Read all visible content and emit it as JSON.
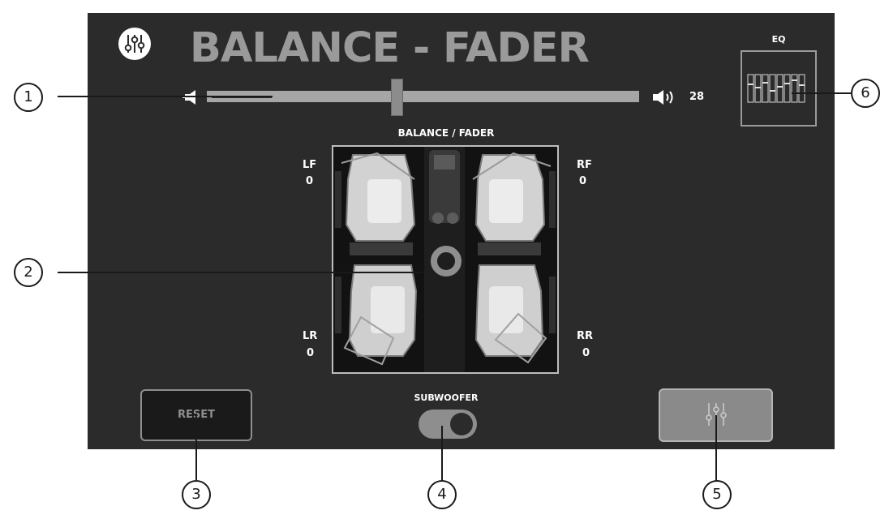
{
  "header": {
    "title": "BALANCE - FADER",
    "app_icon": "sliders-icon"
  },
  "volume": {
    "low_icon": "speaker-low-icon",
    "high_icon": "speaker-high-icon",
    "value": "28",
    "level_fraction": 0.44
  },
  "eq_preview": {
    "label": "EQ",
    "icon": "eq-sliders-icon"
  },
  "balance_fader": {
    "label": "BALANCE / FADER",
    "speakers": {
      "lf": {
        "label": "LF",
        "value": "0"
      },
      "rf": {
        "label": "RF",
        "value": "0"
      },
      "lr": {
        "label": "LR",
        "value": "0"
      },
      "rr": {
        "label": "RR",
        "value": "0"
      }
    }
  },
  "reset": {
    "label": "RESET"
  },
  "subwoofer": {
    "label": "SUBWOOFER",
    "state": "on"
  },
  "eq_button": {
    "icon": "sliders-icon"
  },
  "callouts": {
    "c1": "1",
    "c2": "2",
    "c3": "3",
    "c4": "4",
    "c5": "5",
    "c6": "6"
  },
  "colors": {
    "screen_bg": "#2b2b2b",
    "title": "#9a9a9a",
    "track": "#a6a6a6"
  }
}
